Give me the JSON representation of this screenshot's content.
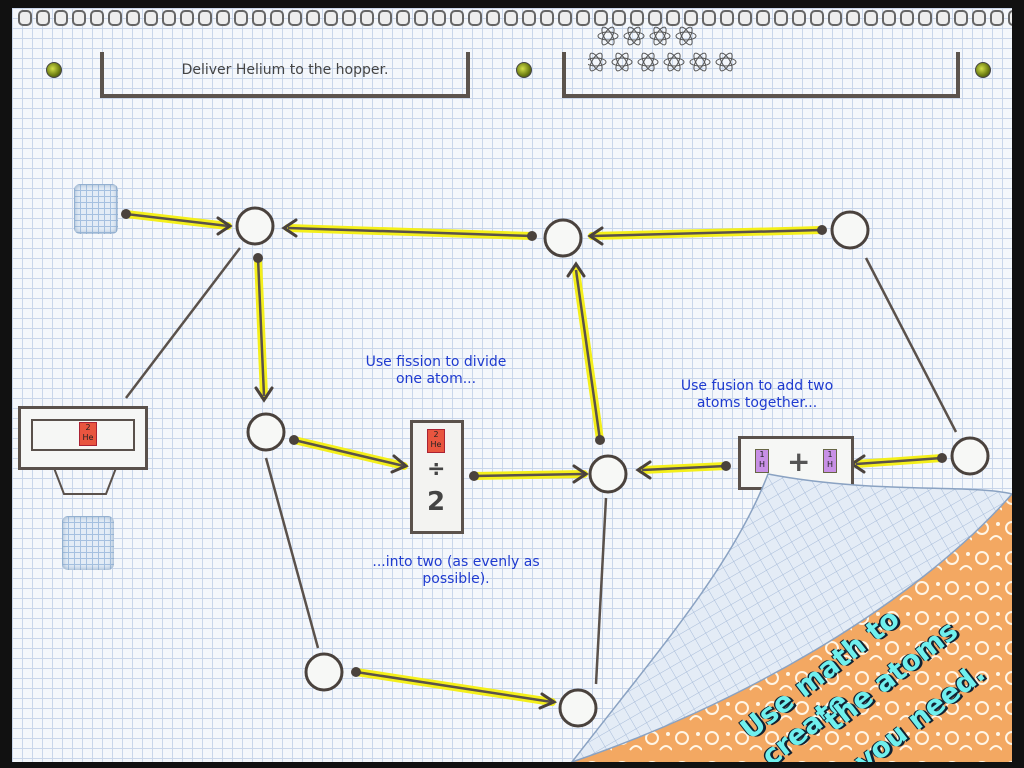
{
  "goal": {
    "text": "Deliver Helium to the hopper."
  },
  "hints": {
    "fission": "Use fission to divide one atom...",
    "fission_result": "...into two (as evenly as possible).",
    "fusion": "Use fusion to add two atoms together..."
  },
  "source_atom": {
    "number": "2",
    "symbol": "He"
  },
  "fission_atom": {
    "number": "2",
    "symbol": "He"
  },
  "fission_divisor": "2",
  "fission_operator": "÷",
  "fusion_atoms": [
    {
      "number": "1",
      "symbol": "H"
    },
    {
      "number": "1",
      "symbol": "H"
    }
  ],
  "fusion_operator": "+",
  "hopper_atom_count": 10,
  "promo": {
    "line1": "Use math to create",
    "line2": "the atoms",
    "line3": "you need."
  },
  "colors": {
    "track_active": "#f4ef1a",
    "line": "#5a514b",
    "hint": "#1f3bd0",
    "promo": "#6ff0ee",
    "he_tile": "#e8553f",
    "h_tile": "#c890e6"
  }
}
